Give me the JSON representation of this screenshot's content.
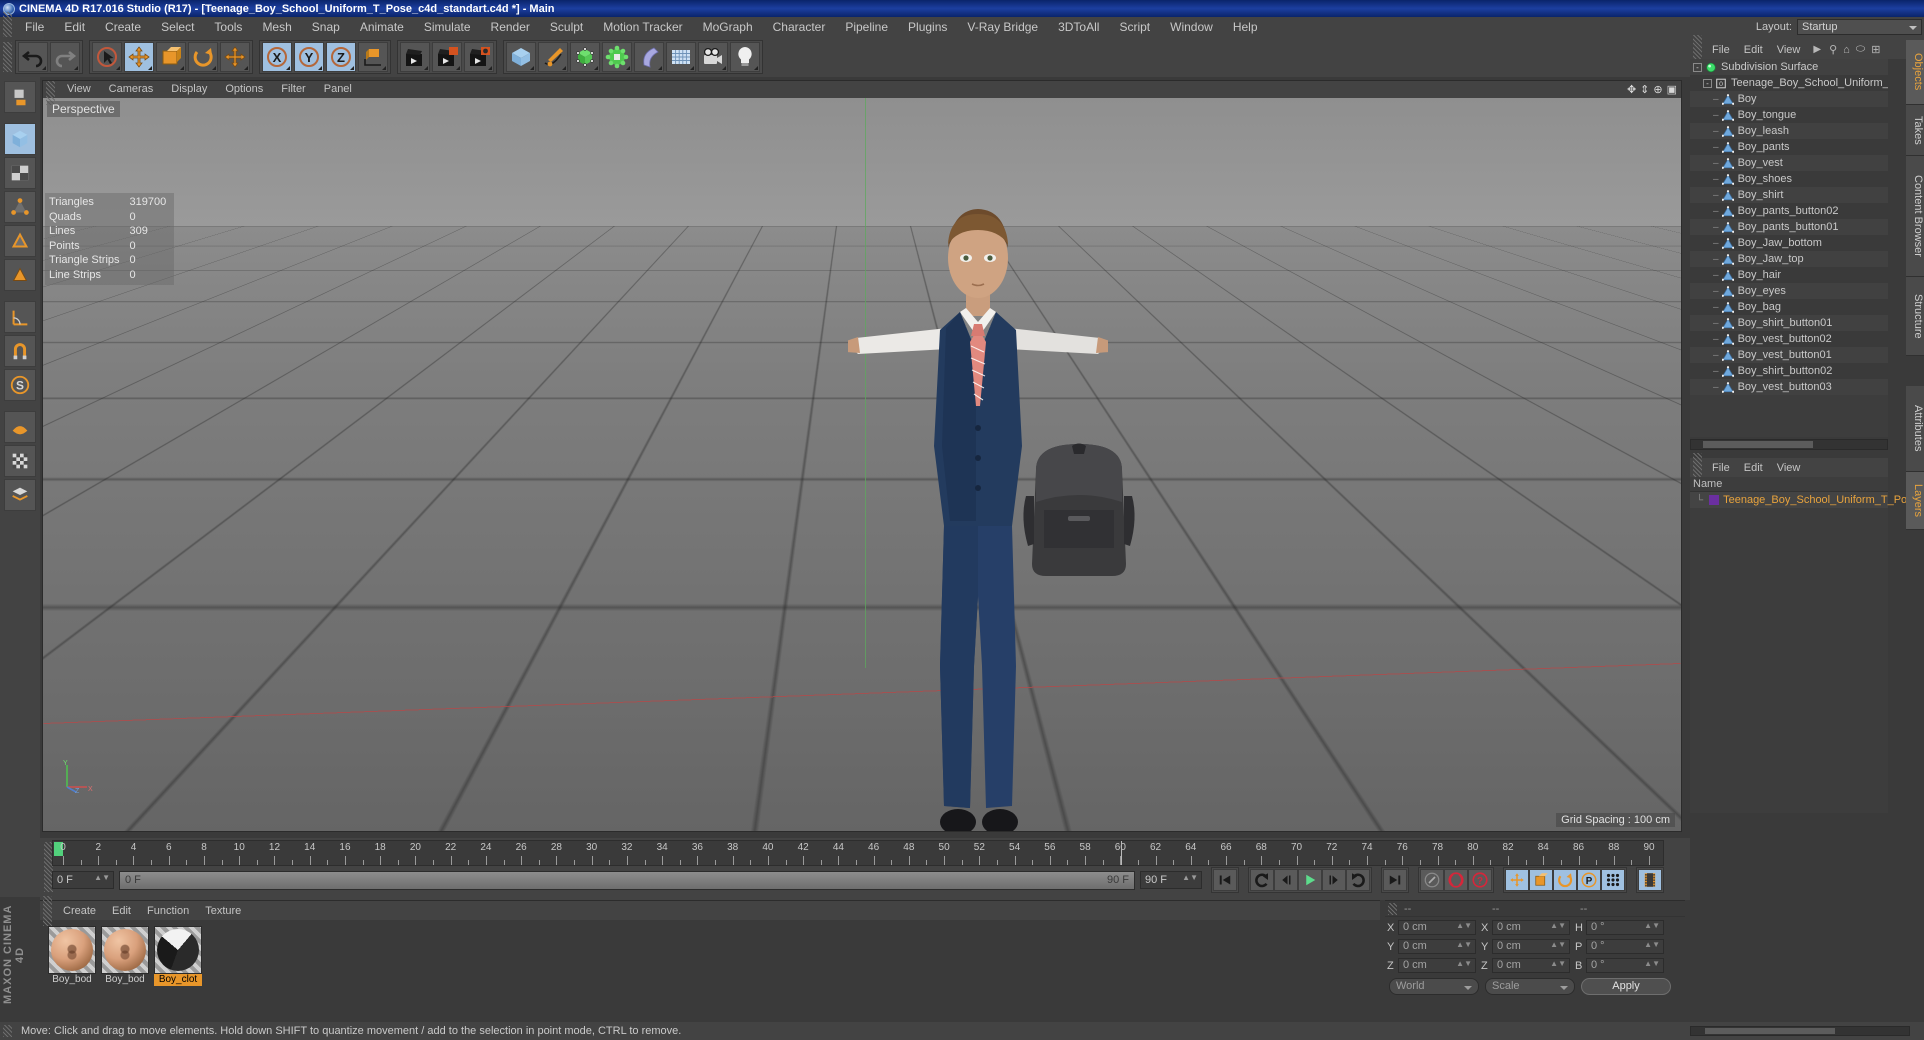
{
  "window": {
    "title": "CINEMA 4D R17.016 Studio (R17) - [Teenage_Boy_School_Uniform_T_Pose_c4d_standart.c4d *] - Main",
    "logo_icon": "c4d-logo-icon"
  },
  "menubar": {
    "items": [
      "File",
      "Edit",
      "Create",
      "Select",
      "Tools",
      "Mesh",
      "Snap",
      "Animate",
      "Simulate",
      "Render",
      "Sculpt",
      "Motion Tracker",
      "MoGraph",
      "Character",
      "Pipeline",
      "Plugins",
      "V-Ray Bridge",
      "3DToAll",
      "Script",
      "Window",
      "Help"
    ],
    "layout_label": "Layout:",
    "layout_value": "Startup"
  },
  "toolbar": {
    "groups": [
      {
        "name": "undo-redo",
        "buttons": [
          {
            "name": "undo-button",
            "icon": "undo-icon",
            "active": false
          },
          {
            "name": "redo-button",
            "icon": "redo-icon",
            "active": false
          }
        ]
      },
      {
        "name": "transform-tools",
        "buttons": [
          {
            "name": "live-selection-button",
            "icon": "cursor-circle-icon",
            "active": false
          },
          {
            "name": "move-tool-button",
            "icon": "move-arrows-icon",
            "active": true
          },
          {
            "name": "scale-tool-button",
            "icon": "scale-box-icon",
            "active": false
          },
          {
            "name": "rotate-tool-button",
            "icon": "rotate-circle-icon",
            "active": false
          },
          {
            "name": "move-axis-button",
            "icon": "move-arrows-icon",
            "active": false
          }
        ]
      },
      {
        "name": "axis-locks",
        "buttons": [
          {
            "name": "lock-x-button",
            "icon": "x-axis-icon",
            "active": true
          },
          {
            "name": "lock-y-button",
            "icon": "y-axis-icon",
            "active": true
          },
          {
            "name": "lock-z-button",
            "icon": "z-axis-icon",
            "active": true
          },
          {
            "name": "world-object-coordinates-button",
            "icon": "world-cube-icon",
            "active": false
          }
        ]
      },
      {
        "name": "render-tools",
        "buttons": [
          {
            "name": "render-view-button",
            "icon": "clapper-icon",
            "active": false
          },
          {
            "name": "render-region-button",
            "icon": "clapper-region-icon",
            "active": false
          },
          {
            "name": "render-settings-button",
            "icon": "clapper-gear-icon",
            "active": false
          }
        ]
      },
      {
        "name": "create-objects",
        "buttons": [
          {
            "name": "add-cube-button",
            "icon": "cube-icon",
            "active": false
          },
          {
            "name": "add-spline-button",
            "icon": "pen-spline-icon",
            "active": false
          },
          {
            "name": "add-generator-button",
            "icon": "green-cube-icon",
            "active": false
          },
          {
            "name": "add-deformer-button",
            "icon": "green-deformer-icon",
            "active": false
          },
          {
            "name": "add-bend-button",
            "icon": "bend-icon",
            "active": false
          },
          {
            "name": "add-floor-button",
            "icon": "floor-grid-icon",
            "active": false
          },
          {
            "name": "add-camera-button",
            "icon": "camera-icon",
            "active": false
          },
          {
            "name": "add-light-button",
            "icon": "lightbulb-icon",
            "active": false
          }
        ]
      }
    ]
  },
  "left_palette": {
    "buttons": [
      {
        "name": "make-editable-button",
        "icon": "make-editable-icon",
        "active": false
      },
      {
        "name": "model-mode-button",
        "icon": "model-cube-icon",
        "active": true
      },
      {
        "name": "texture-mode-button",
        "icon": "texture-checker-icon",
        "active": false
      },
      {
        "name": "points-mode-button",
        "icon": "points-icon",
        "active": false
      },
      {
        "name": "edges-mode-button",
        "icon": "edges-icon",
        "active": false
      },
      {
        "name": "polygons-mode-button",
        "icon": "polygons-icon",
        "active": false
      },
      {
        "name": "axis-modify-button",
        "icon": "axis-angle-icon",
        "active": false
      },
      {
        "name": "enable-axis-button",
        "icon": "magnet-axis-icon",
        "active": false
      },
      {
        "name": "snap-button",
        "icon": "snap-s-icon",
        "active": false
      },
      {
        "name": "workplane-button",
        "icon": "workplane-icon",
        "active": false
      },
      {
        "name": "viewport-solo-button",
        "icon": "checker-icon",
        "active": false
      },
      {
        "name": "layer-filter-button",
        "icon": "layer-icon",
        "active": false
      }
    ],
    "brand": "MAXON CINEMA 4D"
  },
  "viewport": {
    "menu": [
      "View",
      "Cameras",
      "Display",
      "Options",
      "Filter",
      "Panel"
    ],
    "camera_label": "Perspective",
    "grid_spacing": "Grid Spacing : 100 cm",
    "axis_gizmo_labels": {
      "y": "Y",
      "x": "X",
      "z": "Z"
    },
    "stats": [
      {
        "label": "Triangles",
        "value": "319700"
      },
      {
        "label": "Quads",
        "value": "0"
      },
      {
        "label": "Lines",
        "value": "309"
      },
      {
        "label": "Points",
        "value": "0"
      },
      {
        "label": "Triangle Strips",
        "value": "0"
      },
      {
        "label": "Line Strips",
        "value": "0"
      }
    ]
  },
  "object_manager": {
    "menu": [
      "File",
      "Edit",
      "View"
    ],
    "tool_icons": [
      "play-arrow-icon",
      "search-icon",
      "home-icon",
      "ellipse-icon",
      "add-layer-icon"
    ],
    "items": [
      {
        "label": "Subdivision Surface",
        "icon": "subdivision-surface-icon",
        "depth": 0,
        "expandable": true
      },
      {
        "label": "Teenage_Boy_School_Uniform_T_P",
        "icon": "null-object-icon",
        "depth": 1,
        "expandable": true
      },
      {
        "label": "Boy",
        "icon": "polygon-object-icon",
        "depth": 2,
        "expandable": false
      },
      {
        "label": "Boy_tongue",
        "icon": "polygon-object-icon",
        "depth": 2,
        "expandable": false
      },
      {
        "label": "Boy_leash",
        "icon": "polygon-object-icon",
        "depth": 2,
        "expandable": false
      },
      {
        "label": "Boy_pants",
        "icon": "polygon-object-icon",
        "depth": 2,
        "expandable": false
      },
      {
        "label": "Boy_vest",
        "icon": "polygon-object-icon",
        "depth": 2,
        "expandable": false
      },
      {
        "label": "Boy_shoes",
        "icon": "polygon-object-icon",
        "depth": 2,
        "expandable": false
      },
      {
        "label": "Boy_shirt",
        "icon": "polygon-object-icon",
        "depth": 2,
        "expandable": false
      },
      {
        "label": "Boy_pants_button02",
        "icon": "polygon-object-icon",
        "depth": 2,
        "expandable": false
      },
      {
        "label": "Boy_pants_button01",
        "icon": "polygon-object-icon",
        "depth": 2,
        "expandable": false
      },
      {
        "label": "Boy_Jaw_bottom",
        "icon": "polygon-object-icon",
        "depth": 2,
        "expandable": false
      },
      {
        "label": "Boy_Jaw_top",
        "icon": "polygon-object-icon",
        "depth": 2,
        "expandable": false
      },
      {
        "label": "Boy_hair",
        "icon": "polygon-object-icon",
        "depth": 2,
        "expandable": false
      },
      {
        "label": "Boy_eyes",
        "icon": "polygon-object-icon",
        "depth": 2,
        "expandable": false
      },
      {
        "label": "Boy_bag",
        "icon": "polygon-object-icon",
        "depth": 2,
        "expandable": false
      },
      {
        "label": "Boy_shirt_button01",
        "icon": "polygon-object-icon",
        "depth": 2,
        "expandable": false
      },
      {
        "label": "Boy_vest_button02",
        "icon": "polygon-object-icon",
        "depth": 2,
        "expandable": false
      },
      {
        "label": "Boy_vest_button01",
        "icon": "polygon-object-icon",
        "depth": 2,
        "expandable": false
      },
      {
        "label": "Boy_shirt_button02",
        "icon": "polygon-object-icon",
        "depth": 2,
        "expandable": false
      },
      {
        "label": "Boy_vest_button03",
        "icon": "polygon-object-icon",
        "depth": 2,
        "expandable": false
      }
    ]
  },
  "right_tabs": [
    {
      "label": "Objects",
      "active": true
    },
    {
      "label": "Takes",
      "active": false
    },
    {
      "label": "Content Browser",
      "active": false
    },
    {
      "label": "Structure",
      "active": false
    }
  ],
  "right_tabs_lower": [
    {
      "label": "Attributes",
      "active": false
    },
    {
      "label": "Layers",
      "active": true
    }
  ],
  "layer_manager": {
    "menu": [
      "File",
      "Edit",
      "View"
    ],
    "column_header": "Name",
    "rows": [
      {
        "label": "Teenage_Boy_School_Uniform_T_Po",
        "color": "#6b2fa0"
      }
    ]
  },
  "timeline": {
    "frame_labels": [
      "0",
      "2",
      "4",
      "6",
      "8",
      "10",
      "12",
      "14",
      "16",
      "18",
      "20",
      "22",
      "24",
      "26",
      "28",
      "30",
      "32",
      "34",
      "36",
      "38",
      "40",
      "42",
      "44",
      "46",
      "48",
      "50",
      "52",
      "54",
      "56",
      "58",
      "60",
      "62",
      "64",
      "66",
      "68",
      "70",
      "72",
      "74",
      "76",
      "78",
      "80",
      "82",
      "84",
      "86",
      "88",
      "90"
    ],
    "current_frame_field": "0 F",
    "start_field": "0 F",
    "scrub_start": "0 F",
    "scrub_end": "90 F",
    "end_field": "90 F",
    "preview_range_field": "90 F",
    "transport": [
      {
        "name": "go-to-start-button",
        "icon": "skip-start-icon"
      },
      {
        "name": "play-backwards-button",
        "icon": "rewind-loop-icon"
      },
      {
        "name": "step-back-button",
        "icon": "step-back-icon"
      },
      {
        "name": "play-button",
        "icon": "play-icon"
      },
      {
        "name": "step-forward-button",
        "icon": "step-forward-icon"
      },
      {
        "name": "play-forwards-button",
        "icon": "forward-loop-icon"
      },
      {
        "name": "go-to-end-button",
        "icon": "skip-end-icon"
      }
    ],
    "record_tools": [
      {
        "name": "autokey-button",
        "icon": "key-icon"
      },
      {
        "name": "record-active-objects-button",
        "icon": "record-icon"
      },
      {
        "name": "keyframe-selection-button",
        "icon": "question-key-icon"
      }
    ],
    "key_tools": [
      {
        "name": "record-position-button",
        "icon": "position-move-icon"
      },
      {
        "name": "record-scale-button",
        "icon": "scale-icon"
      },
      {
        "name": "record-rotation-button",
        "icon": "rotation-icon"
      },
      {
        "name": "record-parameter-button",
        "icon": "parameter-p-icon"
      },
      {
        "name": "record-pla-button",
        "icon": "point-level-animation-icon"
      },
      {
        "name": "timeline-button",
        "icon": "filmstrip-icon"
      }
    ]
  },
  "material_manager": {
    "menu": [
      "Create",
      "Edit",
      "Function",
      "Texture"
    ],
    "materials": [
      {
        "label": "Boy_bod",
        "type": "skin",
        "selected": false
      },
      {
        "label": "Boy_bod",
        "type": "skin",
        "selected": false
      },
      {
        "label": "Boy_clot",
        "type": "cloth",
        "selected": true
      }
    ]
  },
  "coordinates": {
    "header": [
      "--",
      "--",
      "--"
    ],
    "rows": [
      {
        "pos_label": "X",
        "pos_value": "0 cm",
        "size_label": "X",
        "size_value": "0 cm",
        "rot_label": "H",
        "rot_value": "0 °"
      },
      {
        "pos_label": "Y",
        "pos_value": "0 cm",
        "size_label": "Y",
        "size_value": "0 cm",
        "rot_label": "P",
        "rot_value": "0 °"
      },
      {
        "pos_label": "Z",
        "pos_value": "0 cm",
        "size_label": "Z",
        "size_value": "0 cm",
        "rot_label": "B",
        "rot_value": "0 °"
      }
    ],
    "system_select": "World",
    "mode_select": "Scale",
    "apply_label": "Apply"
  },
  "status_bar": {
    "message": "Move: Click and drag to move elements. Hold down SHIFT to quantize movement / add to the selection in point mode, CTRL to remove."
  },
  "colors": {
    "accent_orange": "#e8962a",
    "active_blue": "#9fc0e0",
    "panel_bg": "#434343",
    "list_bg": "#3d3d3d",
    "title_blue": "#0a246a"
  }
}
